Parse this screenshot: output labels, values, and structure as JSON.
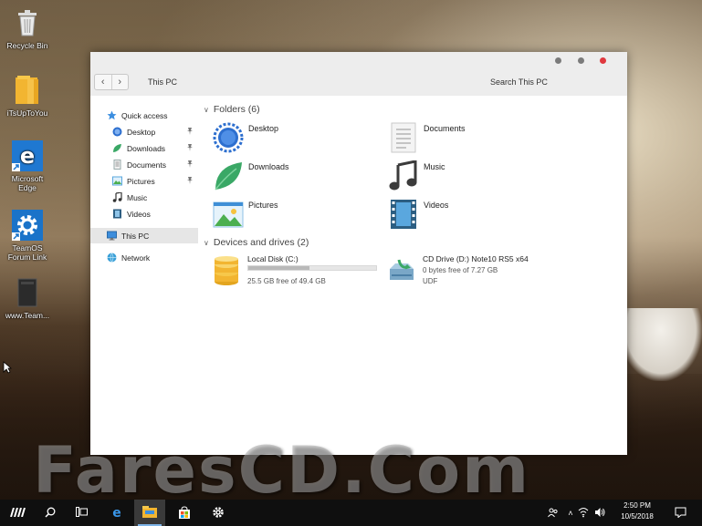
{
  "desktop": {
    "icons": [
      {
        "label": "Recycle Bin",
        "icon": "recycle-bin-icon"
      },
      {
        "label": "iTsUpToYou",
        "icon": "folder-icon"
      },
      {
        "label": "Microsoft Edge",
        "icon": "edge-icon"
      },
      {
        "label": "TeamOS Forum Link",
        "icon": "gear-icon"
      },
      {
        "label": "www.Team...",
        "icon": "file-icon"
      }
    ],
    "watermark": "FaresCD.Com"
  },
  "window": {
    "breadcrumb": "This PC",
    "search_placeholder": "Search This PC",
    "controls": {
      "minimize_color": "#7b7b7b",
      "maximize_color": "#7b7b7b",
      "close_color": "#e0383e"
    },
    "sidebar": {
      "quick_access": "Quick access",
      "items": [
        {
          "label": "Desktop",
          "icon": "desktop-icon",
          "pinned": true
        },
        {
          "label": "Downloads",
          "icon": "downloads-icon",
          "pinned": true
        },
        {
          "label": "Documents",
          "icon": "documents-icon",
          "pinned": true
        },
        {
          "label": "Pictures",
          "icon": "pictures-icon",
          "pinned": true
        },
        {
          "label": "Music",
          "icon": "music-icon",
          "pinned": false
        },
        {
          "label": "Videos",
          "icon": "videos-icon",
          "pinned": false
        }
      ],
      "this_pc": "This PC",
      "network": "Network"
    },
    "folders": {
      "heading": "Folders (6)",
      "items": [
        {
          "label": "Desktop",
          "icon": "desktop-folder-icon"
        },
        {
          "label": "Documents",
          "icon": "documents-folder-icon"
        },
        {
          "label": "Downloads",
          "icon": "downloads-folder-icon"
        },
        {
          "label": "Music",
          "icon": "music-folder-icon"
        },
        {
          "label": "Pictures",
          "icon": "pictures-folder-icon"
        },
        {
          "label": "Videos",
          "icon": "videos-folder-icon"
        }
      ]
    },
    "drives": {
      "heading": "Devices and drives (2)",
      "items": [
        {
          "label": "Local Disk (C:)",
          "detail": "25.5 GB free of 49.4 GB",
          "used_fraction": 0.48,
          "icon": "hard-disk-icon"
        },
        {
          "label": "CD Drive (D:) Note10 RS5 x64",
          "detail": "0 bytes free of 7.27 GB",
          "extra": "UDF",
          "icon": "cd-drive-icon"
        }
      ]
    }
  },
  "taskbar": {
    "time": "2:50 PM",
    "date": "10/5/2018",
    "accent": "#7fb5e8"
  }
}
